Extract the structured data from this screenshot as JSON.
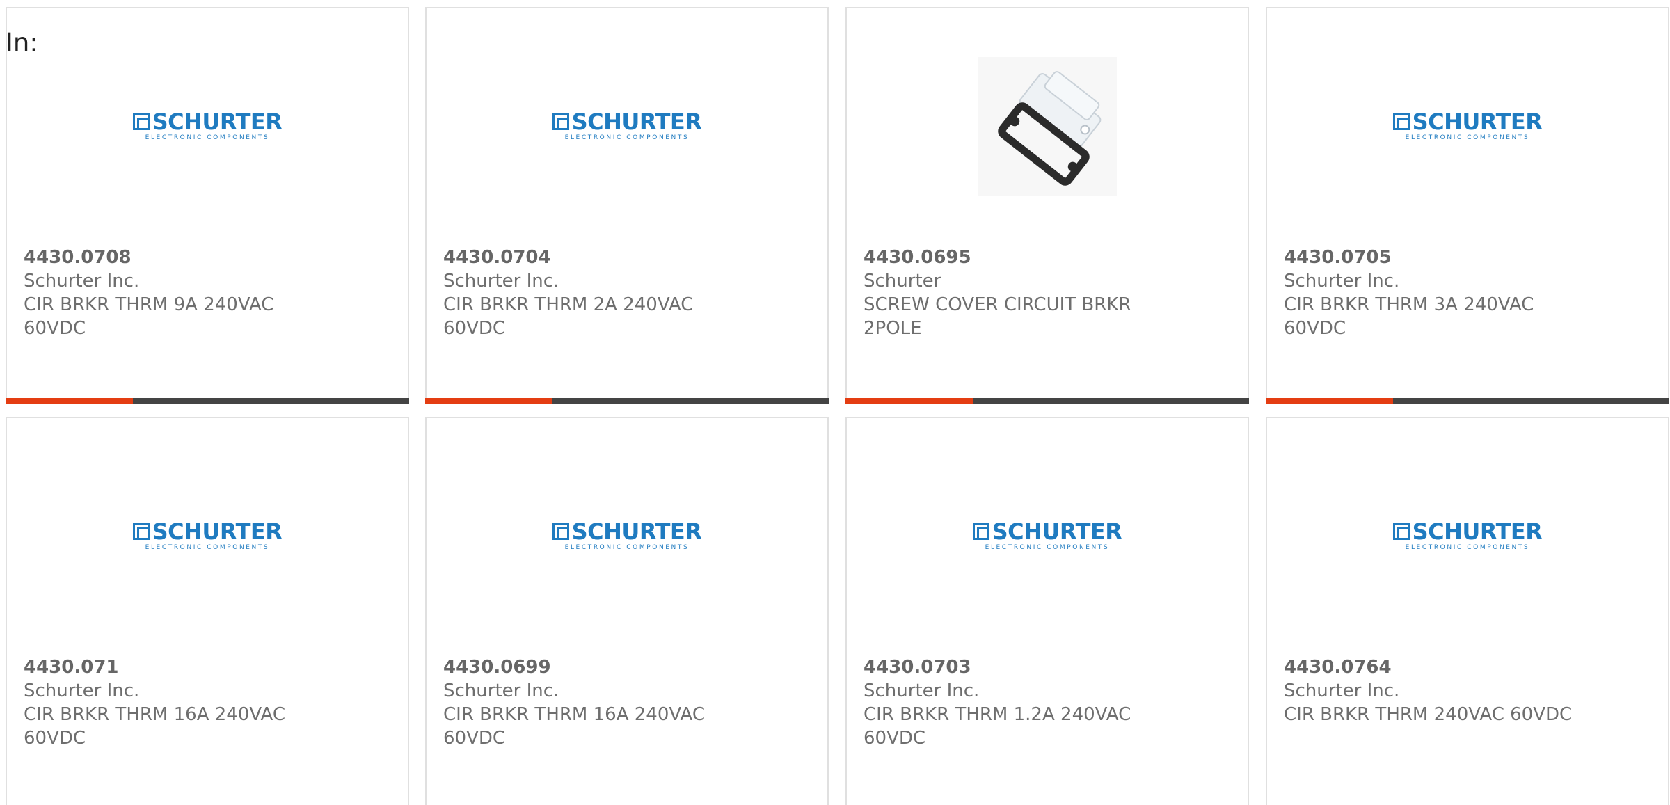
{
  "header": {
    "filter_label": "In:"
  },
  "logo": {
    "brand": "SCHURTER",
    "tagline": "ELECTRONIC COMPONENTS"
  },
  "colors": {
    "accent": "#e43d12",
    "bar": "#444444",
    "brand_blue": "#1f7bc0",
    "text": "#666666"
  },
  "products": [
    {
      "part_number": "4430.0708",
      "manufacturer": "Schurter Inc.",
      "description": "CIR BRKR THRM 9A 240VAC 60VDC",
      "image": "schurter-logo"
    },
    {
      "part_number": "4430.0704",
      "manufacturer": "Schurter Inc.",
      "description": "CIR BRKR THRM 2A 240VAC 60VDC",
      "image": "schurter-logo"
    },
    {
      "part_number": "4430.0695",
      "manufacturer": "Schurter",
      "description": "SCREW COVER CIRCUIT BRKR 2POLE",
      "image": "screw-cover-photo"
    },
    {
      "part_number": "4430.0705",
      "manufacturer": "Schurter Inc.",
      "description": "CIR BRKR THRM 3A 240VAC 60VDC",
      "image": "schurter-logo"
    },
    {
      "part_number": "4430.071",
      "manufacturer": "Schurter Inc.",
      "description": "CIR BRKR THRM 16A 240VAC 60VDC",
      "image": "schurter-logo"
    },
    {
      "part_number": "4430.0699",
      "manufacturer": "Schurter Inc.",
      "description": "CIR BRKR THRM 16A 240VAC 60VDC",
      "image": "schurter-logo"
    },
    {
      "part_number": "4430.0703",
      "manufacturer": "Schurter Inc.",
      "description": "CIR BRKR THRM 1.2A 240VAC 60VDC",
      "image": "schurter-logo"
    },
    {
      "part_number": "4430.0764",
      "manufacturer": "Schurter Inc.",
      "description": "CIR BRKR THRM 240VAC 60VDC",
      "image": "schurter-logo"
    }
  ]
}
